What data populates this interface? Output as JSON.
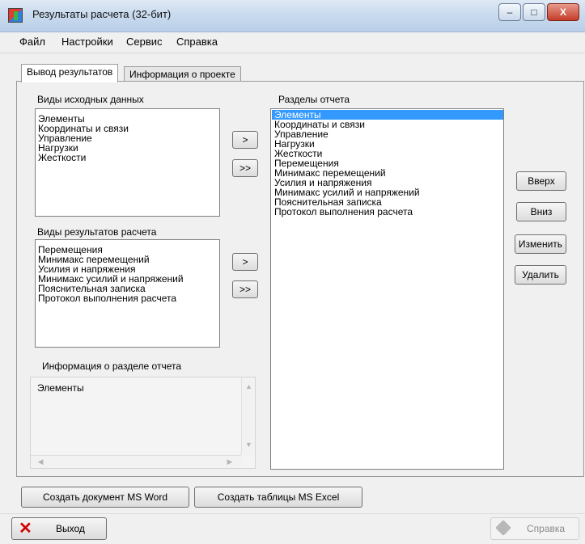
{
  "window": {
    "title": "Результаты расчета (32-бит)",
    "controls": [
      "–",
      "□",
      "X"
    ]
  },
  "menu": [
    "Файл",
    "Настройки",
    "Сервис",
    "Справка"
  ],
  "tabs": [
    {
      "label": "Вывод результатов",
      "active": true
    },
    {
      "label": "Информация о проекте",
      "active": false
    }
  ],
  "source_data": {
    "label": "Виды исходных данных",
    "items": [
      "Элементы",
      "Координаты и связи",
      "Управление",
      "Нагрузки",
      "Жесткости"
    ]
  },
  "result_types": {
    "label": "Виды результатов расчета",
    "items": [
      "Перемещения",
      "Минимакс перемещений",
      "Усилия и напряжения",
      "Минимакс усилий и напряжений",
      "Пояснительная записка",
      "Протокол выполнения расчета"
    ]
  },
  "report_sections": {
    "label": "Разделы отчета",
    "selected_index": 0,
    "items": [
      "Элементы",
      "Координаты и связи",
      "Управление",
      "Нагрузки",
      "Жесткости",
      "Перемещения",
      "Минимакс перемещений",
      "Усилия и напряжения",
      "Минимакс усилий и напряжений",
      "Пояснительная записка",
      "Протокол выполнения расчета"
    ]
  },
  "transfer_buttons": {
    "add": ">",
    "add_all": ">>"
  },
  "side_buttons": {
    "up": "Вверх",
    "down": "Вниз",
    "edit": "Изменить",
    "delete": "Удалить"
  },
  "section_info": {
    "label": "Информация о разделе отчета",
    "text": "Элементы"
  },
  "bottom_buttons": {
    "word": "Создать документ MS Word",
    "excel": "Создать таблицы MS Excel"
  },
  "footer": {
    "exit": "Выход",
    "help": "Справка"
  },
  "colors": {
    "selection": "#3399ff",
    "exit_icon": "#d10000"
  }
}
